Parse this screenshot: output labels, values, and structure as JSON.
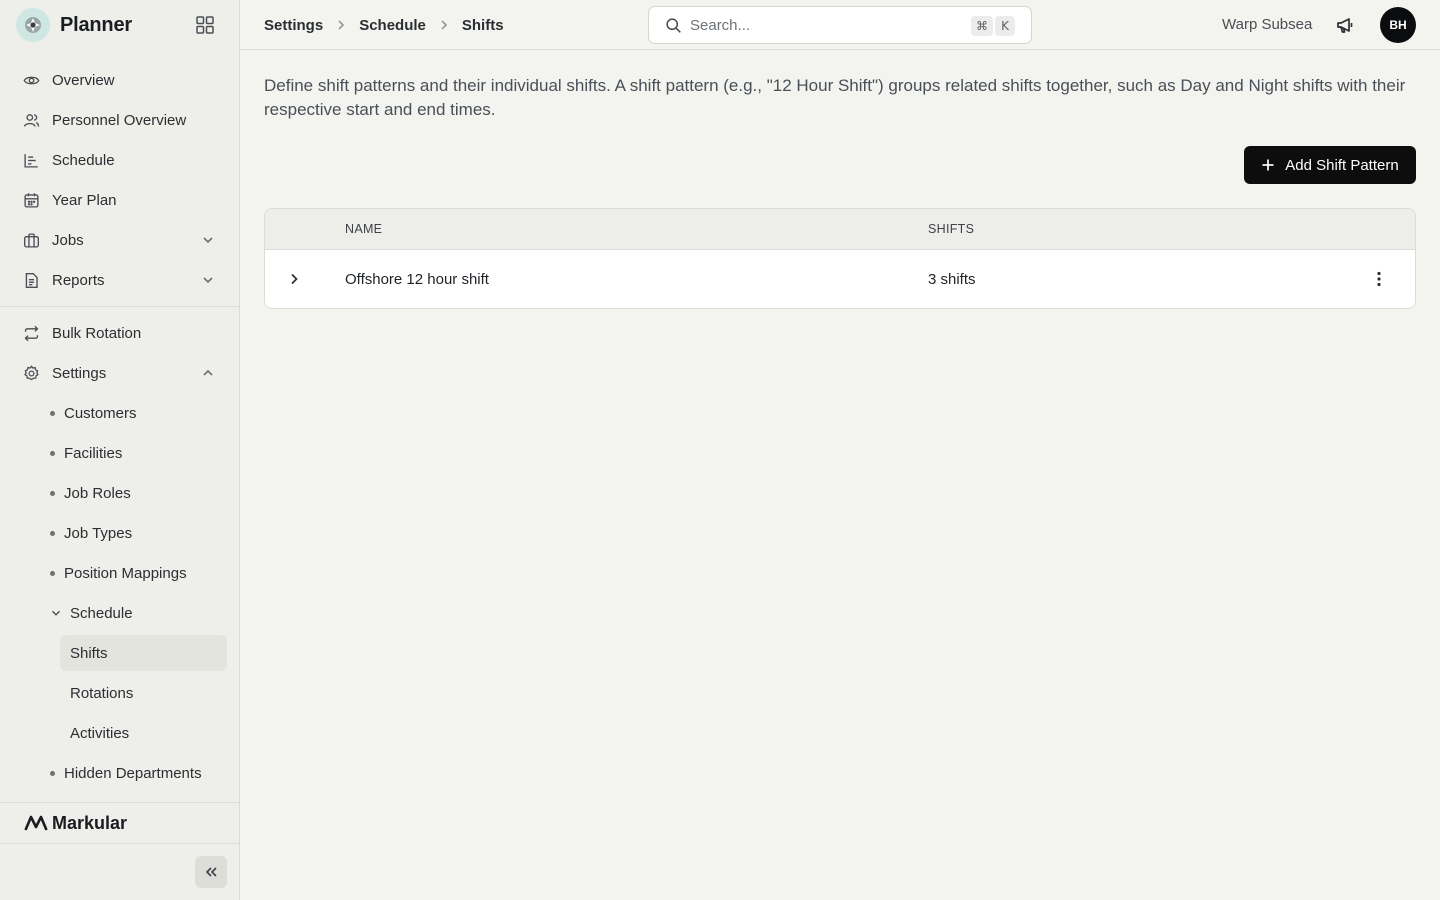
{
  "app": {
    "name": "Planner",
    "footer_brand": "Markular"
  },
  "sidebar": {
    "nav": [
      {
        "label": "Overview",
        "icon": "eye-icon"
      },
      {
        "label": "Personnel Overview",
        "icon": "users-icon"
      },
      {
        "label": "Schedule",
        "icon": "bar-chart-icon"
      },
      {
        "label": "Year Plan",
        "icon": "calendar-icon"
      },
      {
        "label": "Jobs",
        "icon": "briefcase-icon",
        "expandable": true
      },
      {
        "label": "Reports",
        "icon": "document-icon",
        "expandable": true
      }
    ],
    "secondary": [
      {
        "label": "Bulk Rotation",
        "icon": "repeat-icon"
      },
      {
        "label": "Settings",
        "icon": "gear-icon",
        "expanded": true
      }
    ],
    "settings_items": [
      "Customers",
      "Facilities",
      "Job Roles",
      "Job Types",
      "Position Mappings"
    ],
    "schedule_group": {
      "label": "Schedule",
      "items": [
        "Shifts",
        "Rotations",
        "Activities"
      ],
      "active": "Shifts"
    },
    "after_items": [
      "Hidden Departments"
    ]
  },
  "topbar": {
    "breadcrumbs": [
      "Settings",
      "Schedule",
      "Shifts"
    ],
    "search": {
      "placeholder": "Search...",
      "shortcut": [
        "⌘",
        "K"
      ]
    },
    "org_name": "Warp Subsea",
    "avatar_initials": "BH"
  },
  "main": {
    "description": "Define shift patterns and their individual shifts. A shift pattern (e.g., \"12 Hour Shift\") groups related shifts together, such as Day and Night shifts with their respective start and end times.",
    "add_button": "Add Shift Pattern",
    "table": {
      "columns": [
        "NAME",
        "SHIFTS"
      ],
      "rows": [
        {
          "name": "Offshore 12 hour shift",
          "shifts": "3 shifts"
        }
      ]
    }
  }
}
